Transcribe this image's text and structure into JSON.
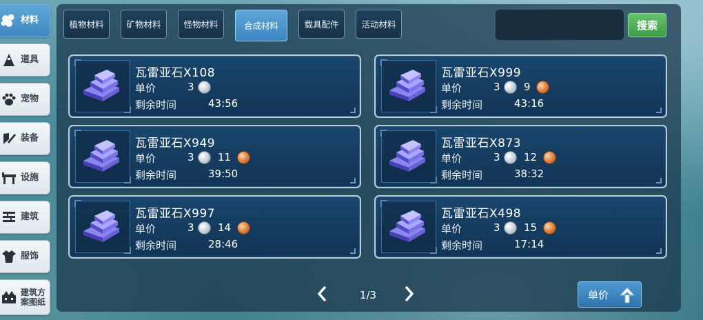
{
  "sidebar": {
    "items": [
      {
        "label": "材料",
        "icon": "materials-icon",
        "active": true
      },
      {
        "label": "道具",
        "icon": "props-icon",
        "active": false
      },
      {
        "label": "宠物",
        "icon": "pet-paw-icon",
        "active": false
      },
      {
        "label": "装备",
        "icon": "equipment-icon",
        "active": false
      },
      {
        "label": "设施",
        "icon": "facility-icon",
        "active": false
      },
      {
        "label": "建筑",
        "icon": "building-icon",
        "active": false
      },
      {
        "label": "服饰",
        "icon": "clothing-icon",
        "active": false
      },
      {
        "label": "建筑方案图纸",
        "icon": "blueprint-icon",
        "active": false
      }
    ]
  },
  "tabs": [
    {
      "label": "植物材料",
      "active": false
    },
    {
      "label": "矿物材料",
      "active": false
    },
    {
      "label": "怪物材料",
      "active": false
    },
    {
      "label": "合成材料",
      "active": true
    },
    {
      "label": "载具配件",
      "active": false
    },
    {
      "label": "活动材料",
      "active": false
    }
  ],
  "search": {
    "value": "",
    "placeholder": "",
    "button_label": "搜索"
  },
  "labels": {
    "price": "单价",
    "time_left": "剩余时间"
  },
  "listings": [
    {
      "name": "瓦雷亚石X108",
      "silver": "3",
      "copper": "",
      "time": "43:56"
    },
    {
      "name": "瓦雷亚石X999",
      "silver": "3",
      "copper": "9",
      "time": "43:16"
    },
    {
      "name": "瓦雷亚石X949",
      "silver": "3",
      "copper": "11",
      "time": "39:50"
    },
    {
      "name": "瓦雷亚石X873",
      "silver": "3",
      "copper": "12",
      "time": "38:32"
    },
    {
      "name": "瓦雷亚石X997",
      "silver": "3",
      "copper": "14",
      "time": "28:46"
    },
    {
      "name": "瓦雷亚石X498",
      "silver": "3",
      "copper": "15",
      "time": "17:14"
    }
  ],
  "pagination": {
    "text": "1/3"
  },
  "sort_button": {
    "label": "单价"
  },
  "colors": {
    "active_tab": "#4a93cc",
    "search_button": "#4fae58",
    "panel": "#18344a",
    "card": "#164068"
  }
}
